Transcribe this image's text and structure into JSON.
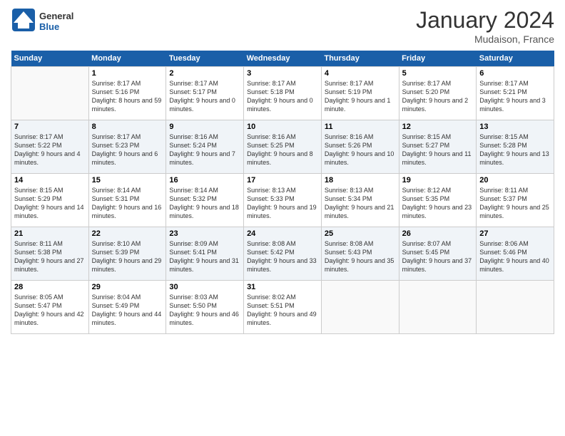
{
  "header": {
    "logo_general": "General",
    "logo_blue": "Blue",
    "month_title": "January 2024",
    "location": "Mudaison, France"
  },
  "weekdays": [
    "Sunday",
    "Monday",
    "Tuesday",
    "Wednesday",
    "Thursday",
    "Friday",
    "Saturday"
  ],
  "weeks": [
    [
      {
        "day": "",
        "sunrise": "",
        "sunset": "",
        "daylight": ""
      },
      {
        "day": "1",
        "sunrise": "Sunrise: 8:17 AM",
        "sunset": "Sunset: 5:16 PM",
        "daylight": "Daylight: 8 hours and 59 minutes."
      },
      {
        "day": "2",
        "sunrise": "Sunrise: 8:17 AM",
        "sunset": "Sunset: 5:17 PM",
        "daylight": "Daylight: 9 hours and 0 minutes."
      },
      {
        "day": "3",
        "sunrise": "Sunrise: 8:17 AM",
        "sunset": "Sunset: 5:18 PM",
        "daylight": "Daylight: 9 hours and 0 minutes."
      },
      {
        "day": "4",
        "sunrise": "Sunrise: 8:17 AM",
        "sunset": "Sunset: 5:19 PM",
        "daylight": "Daylight: 9 hours and 1 minute."
      },
      {
        "day": "5",
        "sunrise": "Sunrise: 8:17 AM",
        "sunset": "Sunset: 5:20 PM",
        "daylight": "Daylight: 9 hours and 2 minutes."
      },
      {
        "day": "6",
        "sunrise": "Sunrise: 8:17 AM",
        "sunset": "Sunset: 5:21 PM",
        "daylight": "Daylight: 9 hours and 3 minutes."
      }
    ],
    [
      {
        "day": "7",
        "sunrise": "Sunrise: 8:17 AM",
        "sunset": "Sunset: 5:22 PM",
        "daylight": "Daylight: 9 hours and 4 minutes."
      },
      {
        "day": "8",
        "sunrise": "Sunrise: 8:17 AM",
        "sunset": "Sunset: 5:23 PM",
        "daylight": "Daylight: 9 hours and 6 minutes."
      },
      {
        "day": "9",
        "sunrise": "Sunrise: 8:16 AM",
        "sunset": "Sunset: 5:24 PM",
        "daylight": "Daylight: 9 hours and 7 minutes."
      },
      {
        "day": "10",
        "sunrise": "Sunrise: 8:16 AM",
        "sunset": "Sunset: 5:25 PM",
        "daylight": "Daylight: 9 hours and 8 minutes."
      },
      {
        "day": "11",
        "sunrise": "Sunrise: 8:16 AM",
        "sunset": "Sunset: 5:26 PM",
        "daylight": "Daylight: 9 hours and 10 minutes."
      },
      {
        "day": "12",
        "sunrise": "Sunrise: 8:15 AM",
        "sunset": "Sunset: 5:27 PM",
        "daylight": "Daylight: 9 hours and 11 minutes."
      },
      {
        "day": "13",
        "sunrise": "Sunrise: 8:15 AM",
        "sunset": "Sunset: 5:28 PM",
        "daylight": "Daylight: 9 hours and 13 minutes."
      }
    ],
    [
      {
        "day": "14",
        "sunrise": "Sunrise: 8:15 AM",
        "sunset": "Sunset: 5:29 PM",
        "daylight": "Daylight: 9 hours and 14 minutes."
      },
      {
        "day": "15",
        "sunrise": "Sunrise: 8:14 AM",
        "sunset": "Sunset: 5:31 PM",
        "daylight": "Daylight: 9 hours and 16 minutes."
      },
      {
        "day": "16",
        "sunrise": "Sunrise: 8:14 AM",
        "sunset": "Sunset: 5:32 PM",
        "daylight": "Daylight: 9 hours and 18 minutes."
      },
      {
        "day": "17",
        "sunrise": "Sunrise: 8:13 AM",
        "sunset": "Sunset: 5:33 PM",
        "daylight": "Daylight: 9 hours and 19 minutes."
      },
      {
        "day": "18",
        "sunrise": "Sunrise: 8:13 AM",
        "sunset": "Sunset: 5:34 PM",
        "daylight": "Daylight: 9 hours and 21 minutes."
      },
      {
        "day": "19",
        "sunrise": "Sunrise: 8:12 AM",
        "sunset": "Sunset: 5:35 PM",
        "daylight": "Daylight: 9 hours and 23 minutes."
      },
      {
        "day": "20",
        "sunrise": "Sunrise: 8:11 AM",
        "sunset": "Sunset: 5:37 PM",
        "daylight": "Daylight: 9 hours and 25 minutes."
      }
    ],
    [
      {
        "day": "21",
        "sunrise": "Sunrise: 8:11 AM",
        "sunset": "Sunset: 5:38 PM",
        "daylight": "Daylight: 9 hours and 27 minutes."
      },
      {
        "day": "22",
        "sunrise": "Sunrise: 8:10 AM",
        "sunset": "Sunset: 5:39 PM",
        "daylight": "Daylight: 9 hours and 29 minutes."
      },
      {
        "day": "23",
        "sunrise": "Sunrise: 8:09 AM",
        "sunset": "Sunset: 5:41 PM",
        "daylight": "Daylight: 9 hours and 31 minutes."
      },
      {
        "day": "24",
        "sunrise": "Sunrise: 8:08 AM",
        "sunset": "Sunset: 5:42 PM",
        "daylight": "Daylight: 9 hours and 33 minutes."
      },
      {
        "day": "25",
        "sunrise": "Sunrise: 8:08 AM",
        "sunset": "Sunset: 5:43 PM",
        "daylight": "Daylight: 9 hours and 35 minutes."
      },
      {
        "day": "26",
        "sunrise": "Sunrise: 8:07 AM",
        "sunset": "Sunset: 5:45 PM",
        "daylight": "Daylight: 9 hours and 37 minutes."
      },
      {
        "day": "27",
        "sunrise": "Sunrise: 8:06 AM",
        "sunset": "Sunset: 5:46 PM",
        "daylight": "Daylight: 9 hours and 40 minutes."
      }
    ],
    [
      {
        "day": "28",
        "sunrise": "Sunrise: 8:05 AM",
        "sunset": "Sunset: 5:47 PM",
        "daylight": "Daylight: 9 hours and 42 minutes."
      },
      {
        "day": "29",
        "sunrise": "Sunrise: 8:04 AM",
        "sunset": "Sunset: 5:49 PM",
        "daylight": "Daylight: 9 hours and 44 minutes."
      },
      {
        "day": "30",
        "sunrise": "Sunrise: 8:03 AM",
        "sunset": "Sunset: 5:50 PM",
        "daylight": "Daylight: 9 hours and 46 minutes."
      },
      {
        "day": "31",
        "sunrise": "Sunrise: 8:02 AM",
        "sunset": "Sunset: 5:51 PM",
        "daylight": "Daylight: 9 hours and 49 minutes."
      },
      {
        "day": "",
        "sunrise": "",
        "sunset": "",
        "daylight": ""
      },
      {
        "day": "",
        "sunrise": "",
        "sunset": "",
        "daylight": ""
      },
      {
        "day": "",
        "sunrise": "",
        "sunset": "",
        "daylight": ""
      }
    ]
  ]
}
